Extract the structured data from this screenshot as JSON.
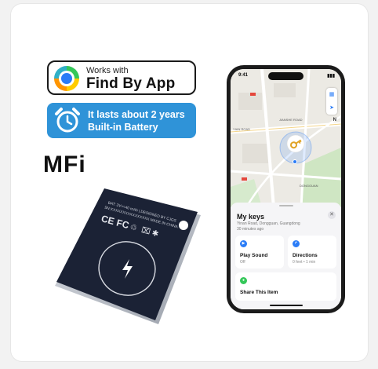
{
  "badges": {
    "find": {
      "small": "Works with",
      "big": "Find By App"
    },
    "battery": {
      "line1": "It lasts about 2 years",
      "line2": "Built-in Battery"
    },
    "mfi": "MFi"
  },
  "tracker": {
    "print_line1": "BAT: 3V==40 mAh | DESIGNED BY CJGS",
    "print_line2": "SN:XXXXXXXXXXXXXXXX    MADE IN CHINA",
    "marks": "CE FC"
  },
  "phone": {
    "status_time": "9:41",
    "map": {
      "label_road_a": "JIANSHE ROAD",
      "label_road_b": "YIAN ROAD",
      "label_road_c": "DONGGUAN",
      "compass": "N",
      "btn_map": "▦",
      "btn_locate": "➤"
    },
    "sheet": {
      "title": "My keys",
      "address": "Yinan Road, Dongguan, Guangdong",
      "time": "30 minutes ago",
      "close": "✕",
      "actions": {
        "play": {
          "label": "Play Sound",
          "sub": "Off"
        },
        "directions": {
          "label": "Directions",
          "sub": "0 feet • 1 min"
        },
        "share": {
          "label": "Share This Item"
        }
      }
    }
  },
  "colors": {
    "battery_banner": "#2f93d8",
    "tracker_body": "#1b2235",
    "findmy_blue": "#2a7cf7"
  }
}
